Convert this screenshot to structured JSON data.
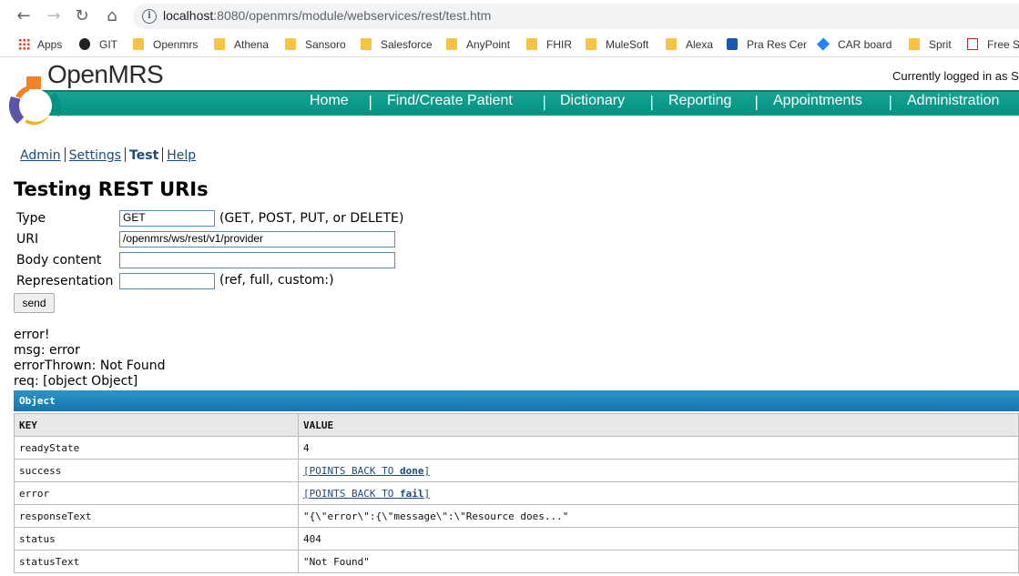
{
  "browser": {
    "url_host": "localhost",
    "url_rest": ":8080/openmrs/module/webservices/rest/test.htm",
    "bookmarks": [
      "Apps",
      "GIT",
      "Openmrs",
      "Athena",
      "Sansoro",
      "Salesforce",
      "AnyPoint",
      "FHIR",
      "MuleSoft",
      "Alexa",
      "Pra Res Cer",
      "CAR board",
      "Sprit",
      "Free SI"
    ]
  },
  "header": {
    "brand": "OpenMRS",
    "logged_in": "Currently logged in as S",
    "nav": [
      "Home",
      "Find/Create Patient",
      "Dictionary",
      "Reporting",
      "Appointments",
      "Administration"
    ]
  },
  "sublinks": {
    "admin": "Admin",
    "settings": "Settings",
    "test": "Test",
    "help": "Help"
  },
  "page": {
    "title": "Testing REST URIs",
    "type_label": "Type",
    "type_value": "GET",
    "type_hint": "(GET, POST, PUT, or DELETE)",
    "uri_label": "URI",
    "uri_value": "/openmrs/ws/rest/v1/provider",
    "body_label": "Body content",
    "body_value": "",
    "rep_label": "Representation",
    "rep_value": "",
    "rep_hint": "(ref, full, custom:)",
    "send_label": "send"
  },
  "error": {
    "line1": "error!",
    "line2": "msg: error",
    "line3": "errorThrown: Not Found",
    "line4": "req: [object Object]"
  },
  "object_table": {
    "title": "Object",
    "col_key": "KEY",
    "col_value": "VALUE",
    "rows": [
      {
        "key": "readyState",
        "value": "4"
      },
      {
        "key": "success",
        "prefix": "[POINTS BACK TO ",
        "bold": "done",
        "suffix": "]"
      },
      {
        "key": "error",
        "prefix": "[POINTS BACK TO ",
        "bold": "fail",
        "suffix": "]"
      },
      {
        "key": "responseText",
        "value": "\"{\\\"error\\\":{\\\"message\\\":\\\"Resource does...\""
      },
      {
        "key": "status",
        "value": "404"
      },
      {
        "key": "statusText",
        "value": "\"Not Found\""
      }
    ]
  },
  "colors": {
    "banner": "#009282",
    "object_header": "#1576ad",
    "link": "#1d4c7a"
  }
}
